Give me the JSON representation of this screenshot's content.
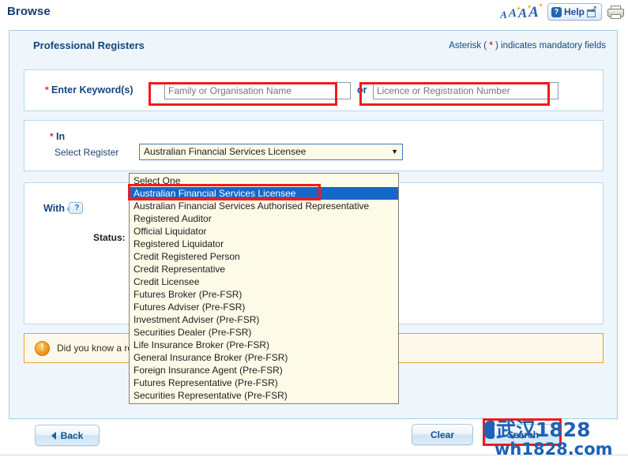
{
  "topbar": {
    "title": "Browse",
    "font_sizes": [
      "A",
      "A",
      "A",
      "A"
    ],
    "help_label": "Help",
    "print_icon": "printer-icon"
  },
  "panel": {
    "title": "Professional Registers",
    "mandatory_note_before": "Asterisk ( ",
    "mandatory_asterisk": "*",
    "mandatory_note_after": " ) indicates mandatory fields"
  },
  "keywords": {
    "label": "Enter Keyword(s)",
    "input1_placeholder": "Family or Organisation Name",
    "input1_value": "",
    "or": "or",
    "input2_placeholder": "Licence or Registration Number",
    "input2_value": ""
  },
  "register": {
    "section_label": "In",
    "field_label": "Select Register",
    "selected_value": "Australian Financial Services Licensee",
    "arrow": "▼",
    "options": [
      "Select One",
      "Australian Financial Services Licensee",
      "Australian Financial Services Authorised Representative",
      "Registered Auditor",
      "Official Liquidator",
      "Registered Liquidator",
      "Credit Registered Person",
      "Credit Representative",
      "Credit Licensee",
      "Futures Broker (Pre-FSR)",
      "Futures Adviser (Pre-FSR)",
      "Investment Adviser (Pre-FSR)",
      "Securities Dealer (Pre-FSR)",
      "Life Insurance Broker (Pre-FSR)",
      "General Insurance Broker (Pre-FSR)",
      "Foreign Insurance Agent (Pre-FSR)",
      "Futures Representative (Pre-FSR)",
      "Securities Representative (Pre-FSR)"
    ],
    "selected_index": 1
  },
  "with_section": {
    "label": "With",
    "help_icon": "question-mark-tooltip-icon",
    "help_glyph": "?",
    "status_label": "Status:"
  },
  "notice": {
    "icon": "exclamation-icon",
    "icon_glyph": "!",
    "text": "Did you know a registered company can reveal more information?"
  },
  "footer": {
    "back_label": "Back",
    "clear_label": "Clear",
    "search_label": "Search"
  },
  "watermark": {
    "line1": "武汉1828",
    "line2": "wh1828.com"
  },
  "colors": {
    "accent_blue": "#14457f",
    "panel_blue": "#eef6fc",
    "highlight_blue": "#1467c8",
    "annotation_red": "#f21a1a",
    "notice_orange": "#e2a33c",
    "mandatory_red": "#d8332a",
    "dropdown_cream": "#fdfbe8"
  }
}
